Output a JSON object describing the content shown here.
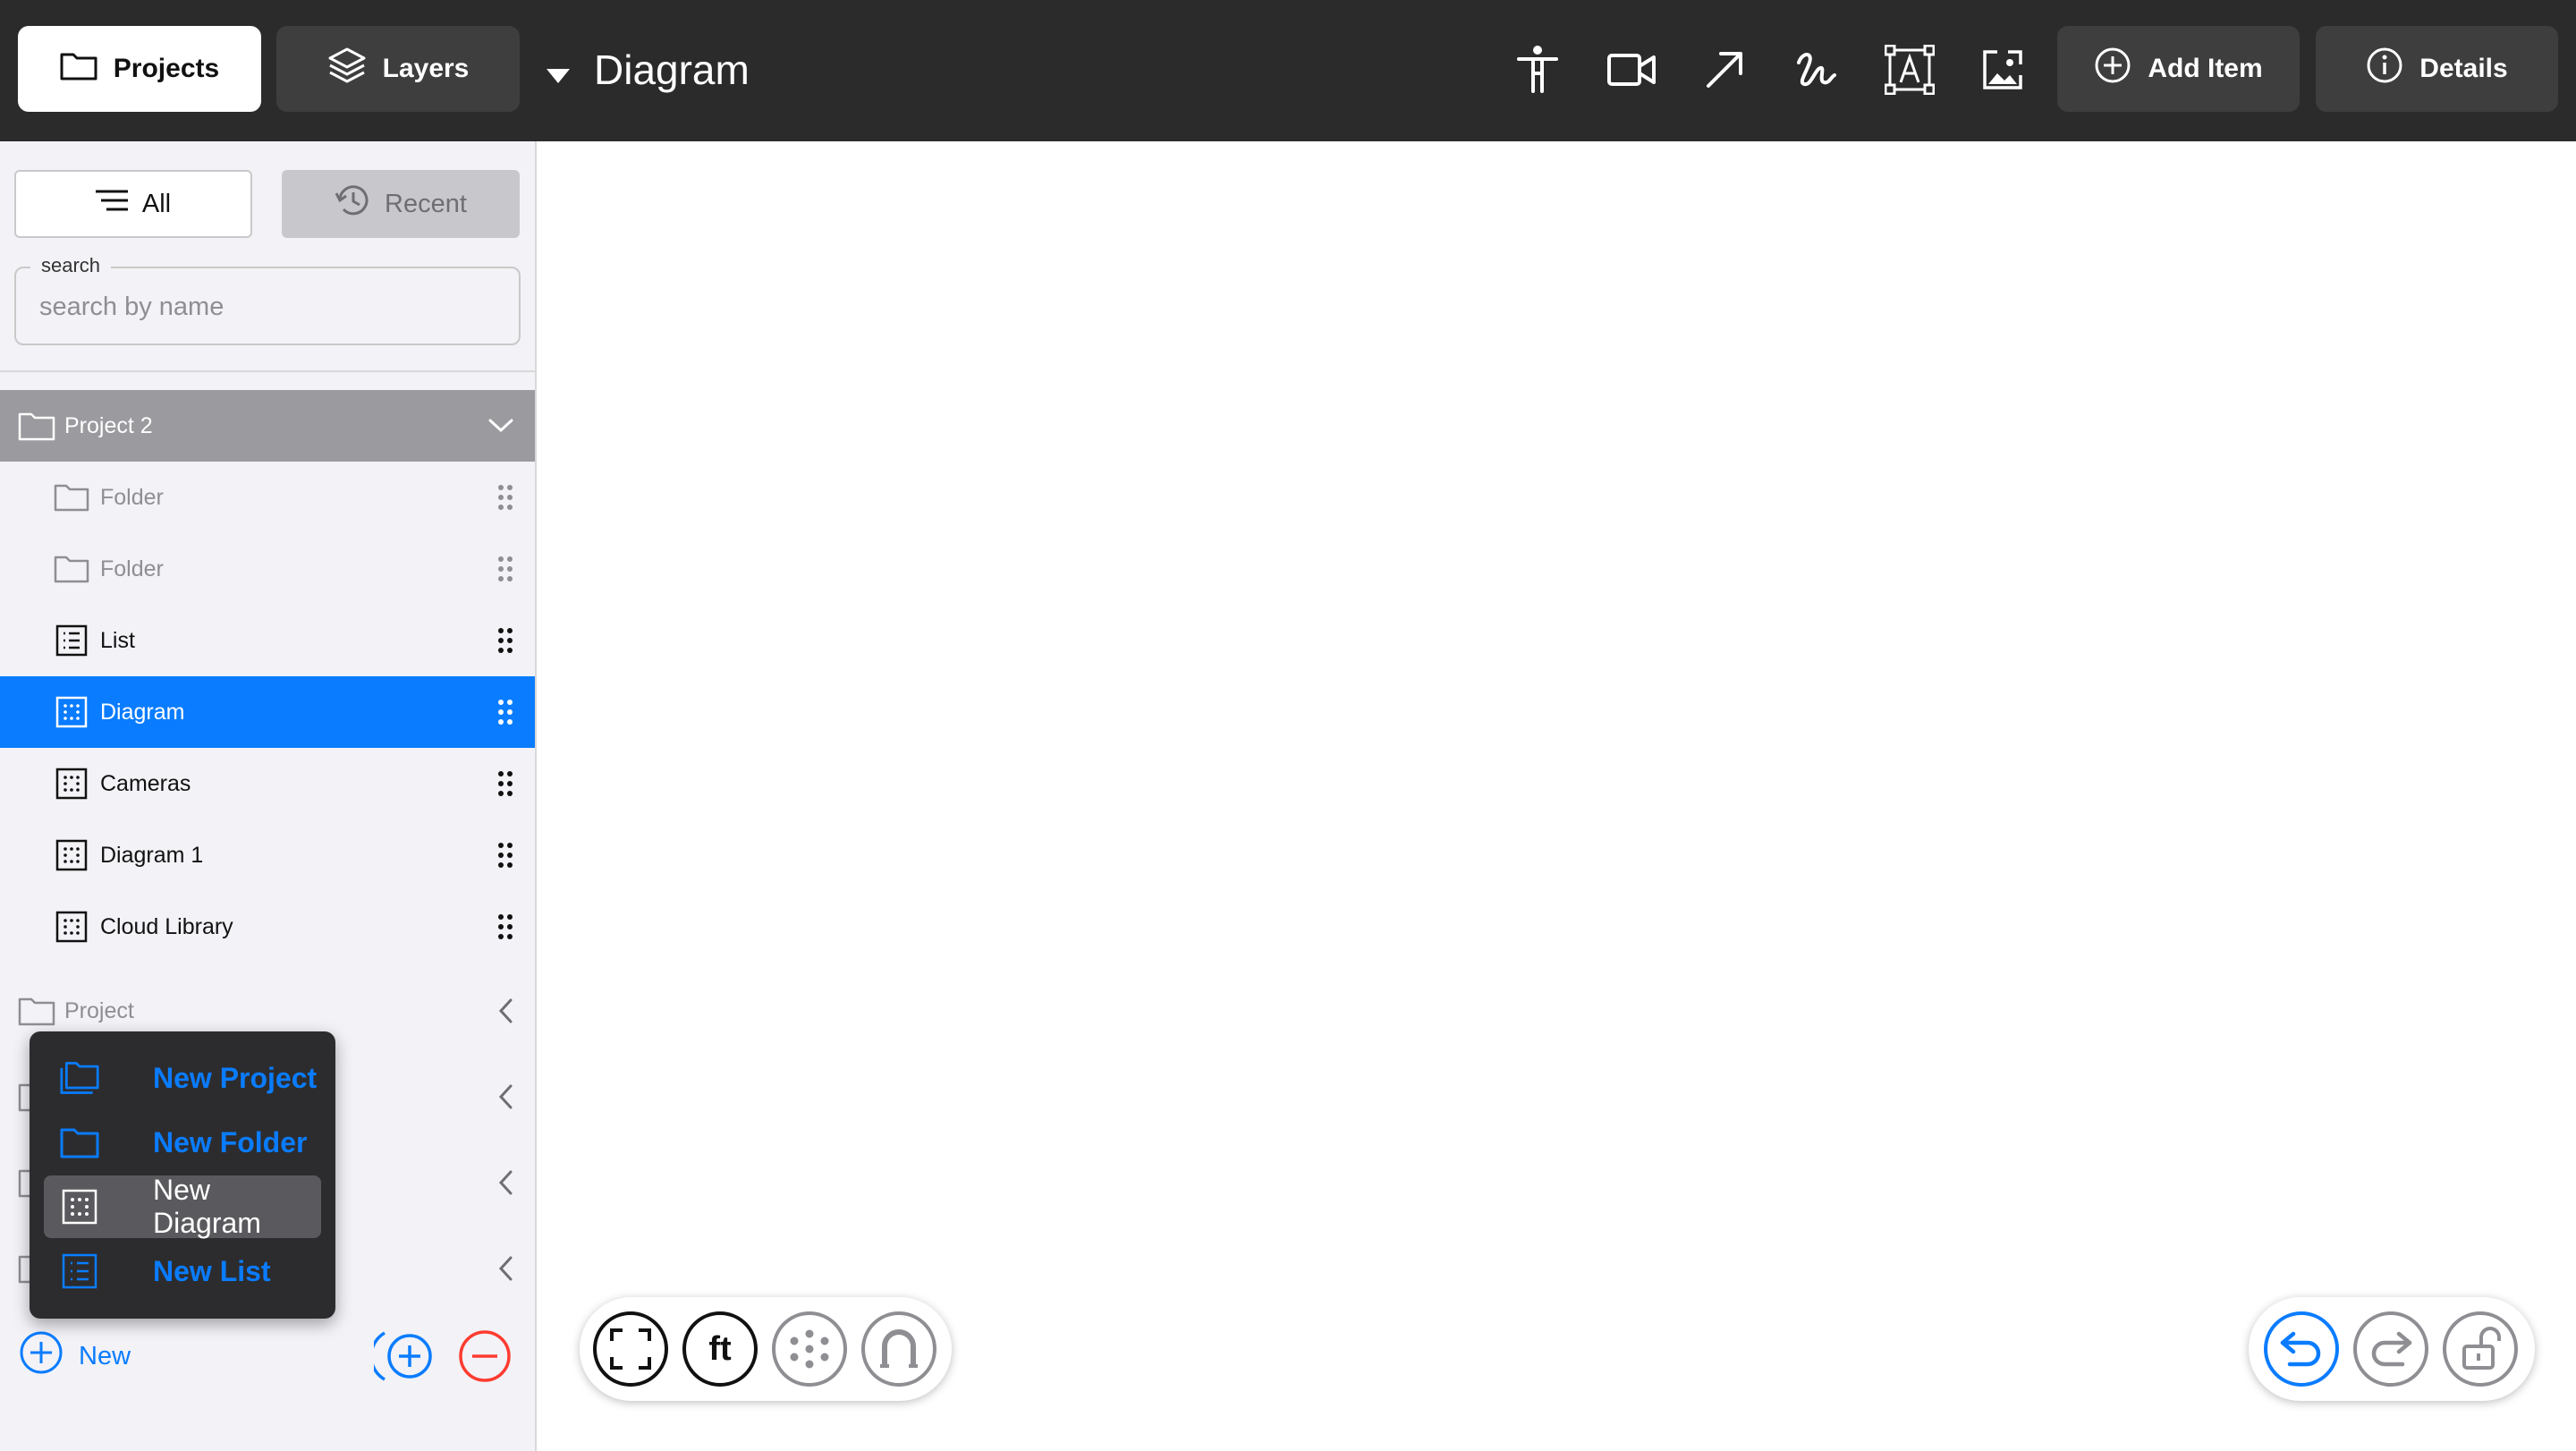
{
  "header": {
    "projects_label": "Projects",
    "layers_label": "Layers",
    "title": "Diagram",
    "add_item_label": "Add Item",
    "details_label": "Details",
    "tools": [
      "accessibility-icon",
      "video-camera-icon",
      "arrow-icon",
      "freehand-icon",
      "text-box-icon",
      "image-icon"
    ]
  },
  "sidebar": {
    "filter_all": "All",
    "filter_recent": "Recent",
    "search_label": "search",
    "search_placeholder": "search by name",
    "search_value": "",
    "expanded_project": {
      "name": "Project 2",
      "children": [
        {
          "label": "Folder",
          "type": "folder"
        },
        {
          "label": "Folder",
          "type": "folder"
        },
        {
          "label": "List",
          "type": "list"
        },
        {
          "label": "Diagram",
          "type": "diagram",
          "selected": true
        },
        {
          "label": "Cameras",
          "type": "diagram"
        },
        {
          "label": "Diagram 1",
          "type": "diagram"
        },
        {
          "label": "Cloud Library",
          "type": "diagram"
        }
      ]
    },
    "collapsed_projects": [
      "Project"
    ],
    "new_label": "New"
  },
  "new_menu": {
    "items": [
      {
        "label": "New Project",
        "icon": "projects-folder-icon"
      },
      {
        "label": "New Folder",
        "icon": "folder-icon"
      },
      {
        "label": "New Diagram",
        "icon": "diagram-icon",
        "active": true
      },
      {
        "label": "New List",
        "icon": "list-icon"
      }
    ]
  },
  "canvas_controls": {
    "units_label": "ft"
  },
  "colors": {
    "header_bg": "#2b2b2b",
    "accent": "#0a7cff",
    "destructive": "#ff3b30",
    "sidebar_bg": "#f2f2f7"
  }
}
